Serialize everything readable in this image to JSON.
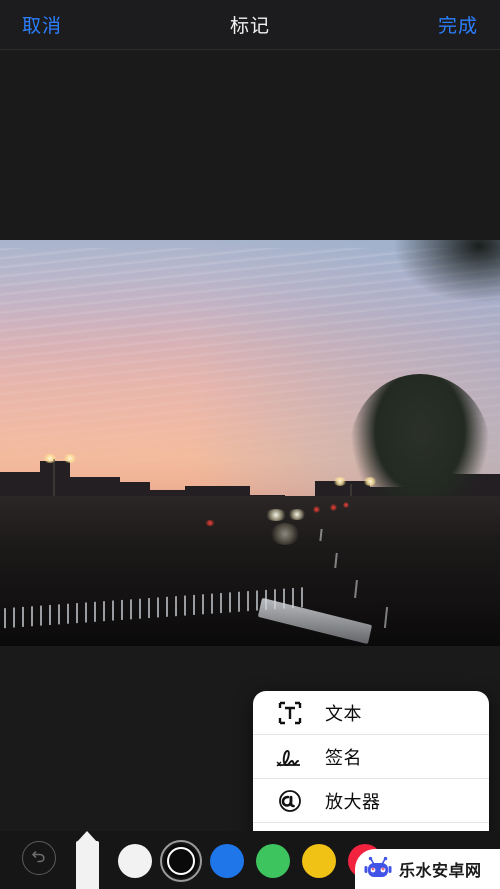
{
  "header": {
    "cancel_label": "取消",
    "title": "标记",
    "done_label": "完成",
    "accent_color": "#2b7fff",
    "title_color": "#f2f2f2",
    "background": "#1c1c1e"
  },
  "canvas": {
    "background": "#1a1a1a",
    "photo_description": "sunset-street-photo"
  },
  "popup_menu": {
    "items": [
      {
        "label": "文本",
        "icon": "text-box-icon"
      },
      {
        "label": "签名",
        "icon": "signature-icon"
      },
      {
        "label": "放大器",
        "icon": "magnifier-icon"
      }
    ],
    "shapes": [
      {
        "icon": "square-shape-icon"
      },
      {
        "icon": "circle-shape-icon"
      },
      {
        "icon": "speech-bubble-shape-icon"
      },
      {
        "icon": "arrow-shape-icon"
      }
    ],
    "background": "#ffffff",
    "text_color": "#0d0d0d"
  },
  "toolbar": {
    "background": "#161617",
    "undo": {
      "icon": "undo-icon",
      "enabled": false
    },
    "pen": {
      "icon": "pen-tool-icon",
      "selected": true,
      "color": "#f2f2f2"
    },
    "swatches": [
      {
        "name": "white",
        "color": "#f2f2f2",
        "selected": false
      },
      {
        "name": "black",
        "color": "#0a0a0a",
        "selected": true
      },
      {
        "name": "blue",
        "color": "#1f76e8",
        "selected": false
      },
      {
        "name": "green",
        "color": "#3ec45f",
        "selected": false
      },
      {
        "name": "yellow",
        "color": "#f0c216",
        "selected": false
      },
      {
        "name": "red",
        "color": "#f2233e",
        "selected": false
      }
    ]
  },
  "watermark": {
    "text": "乐水安卓网",
    "icon": "robot-mascot-icon",
    "icon_color": "#4254e8",
    "background": "#ffffff"
  }
}
